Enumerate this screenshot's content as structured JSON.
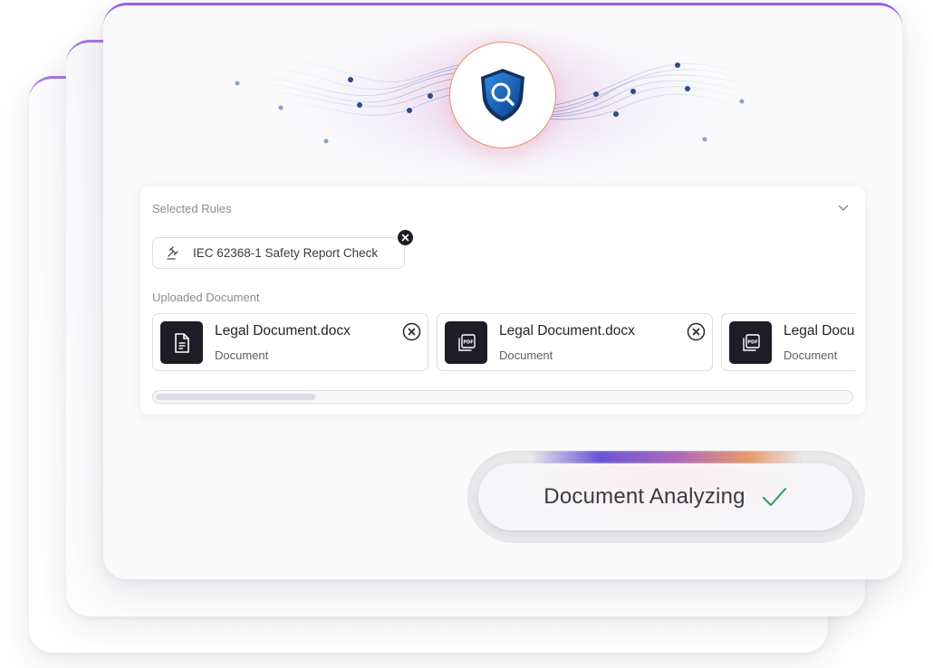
{
  "selected_rules": {
    "label": "Selected Rules",
    "rule": {
      "text": "IEC 62368-1 Safety Report Check",
      "icon": "gavel-icon"
    }
  },
  "uploaded": {
    "label": "Uploaded Document",
    "documents": [
      {
        "name": "Legal Document.docx",
        "type": "Document",
        "icon": "document-icon"
      },
      {
        "name": "Legal Document.docx",
        "type": "Document",
        "icon": "pdf-icon"
      },
      {
        "name": "Legal Document.docx",
        "type": "Document",
        "icon": "pdf-icon"
      }
    ],
    "scroll_fraction": 0.23
  },
  "status": {
    "text": "Document Analyzing",
    "icon": "checkmark-icon",
    "check_color": "#22a35a"
  },
  "hero": {
    "icon": "shield-search-icon",
    "accent": "#9a5cf0"
  }
}
